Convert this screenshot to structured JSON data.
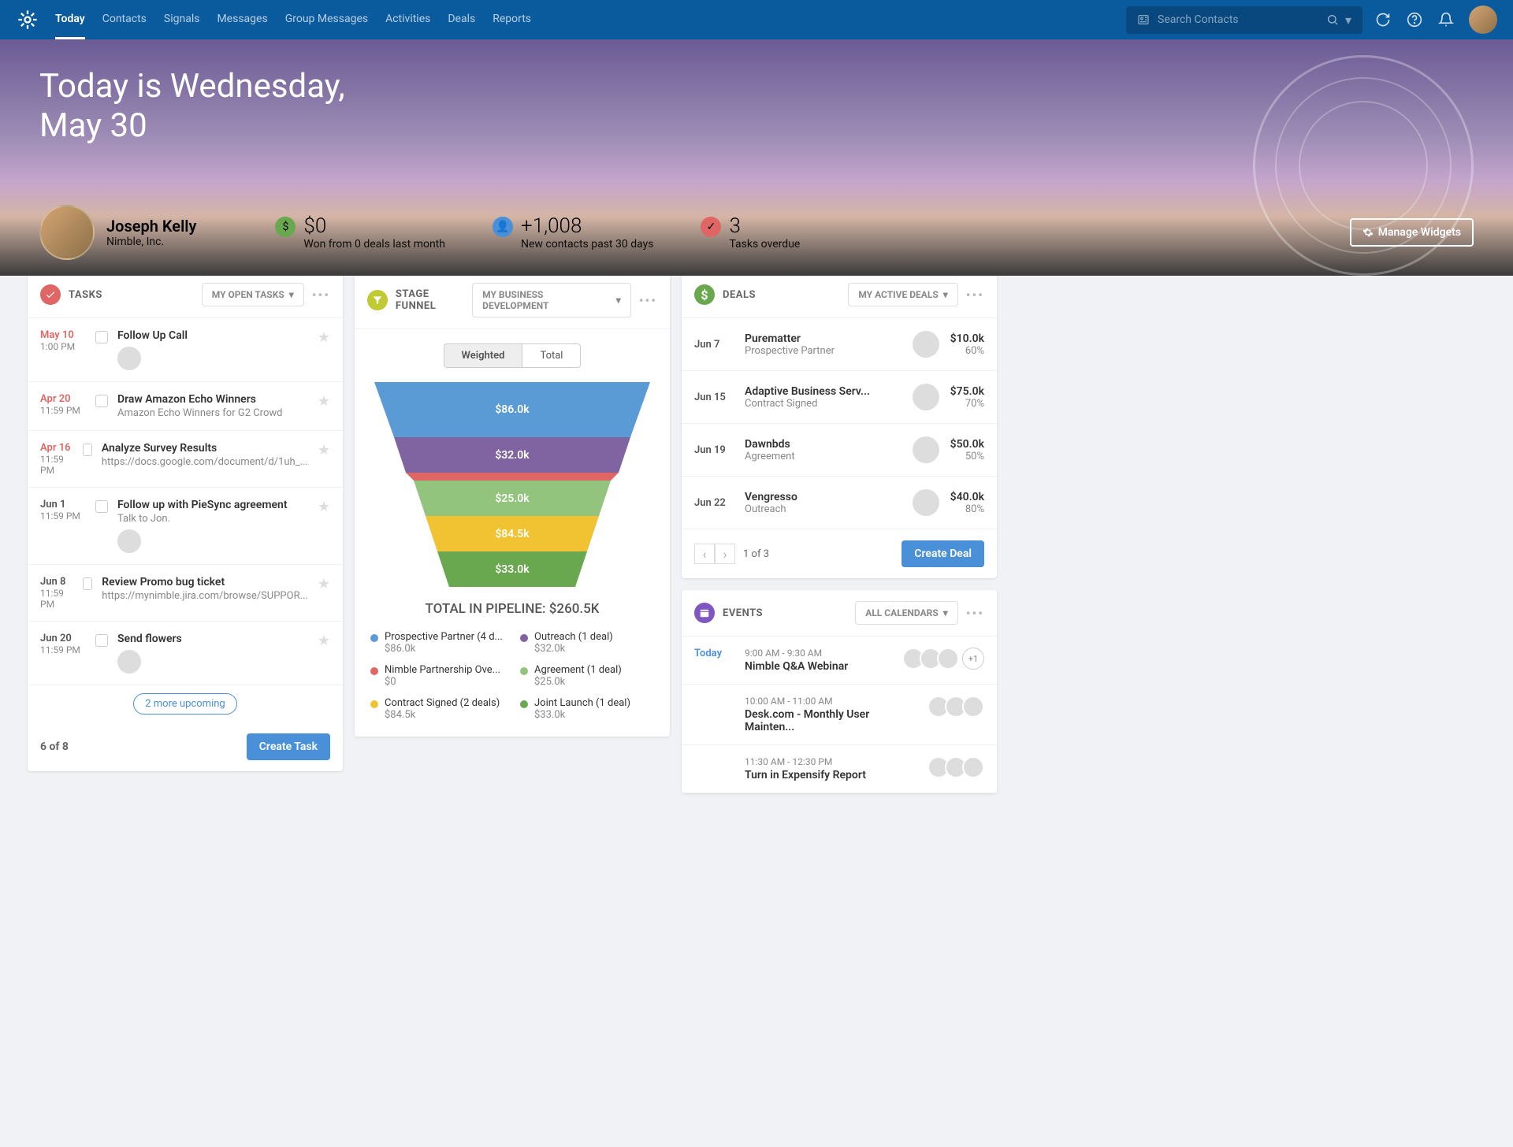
{
  "nav": {
    "items": [
      "Today",
      "Contacts",
      "Signals",
      "Messages",
      "Group Messages",
      "Activities",
      "Deals",
      "Reports"
    ],
    "search_placeholder": "Search Contacts"
  },
  "hero": {
    "title_line1": "Today is Wednesday,",
    "title_line2": "May 30",
    "user_name": "Joseph Kelly",
    "user_company": "Nimble, Inc.",
    "stat1_prefix": "$",
    "stat1_val": "0",
    "stat1_label": "Won from 0 deals last month",
    "stat2_prefix": "+",
    "stat2_val": "1,008",
    "stat2_label": "New contacts past 30 days",
    "stat3_val": "3",
    "stat3_label": "Tasks overdue",
    "manage_btn": "Manage Widgets"
  },
  "tasks": {
    "title": "TASKS",
    "dropdown": "MY OPEN TASKS",
    "items": [
      {
        "date": "May 10",
        "time": "1:00 PM",
        "overdue": true,
        "title": "Follow Up Call",
        "sub": "",
        "avatar": true
      },
      {
        "date": "Apr 20",
        "time": "11:59 PM",
        "overdue": true,
        "title": "Draw Amazon Echo Winners",
        "sub": "Amazon Echo Winners for G2 Crowd"
      },
      {
        "date": "Apr 16",
        "time": "11:59 PM",
        "overdue": true,
        "title": "Analyze Survey Results",
        "sub": "https://docs.google.com/document/d/1uh_..."
      },
      {
        "date": "Jun 1",
        "time": "11:59 PM",
        "overdue": false,
        "title": "Follow up with PieSync agreement",
        "sub": "Talk to Jon.",
        "avatar": true
      },
      {
        "date": "Jun 8",
        "time": "11:59 PM",
        "overdue": false,
        "title": "Review Promo bug ticket",
        "sub": "https://mynimble.jira.com/browse/SUPPOR..."
      },
      {
        "date": "Jun 20",
        "time": "11:59 PM",
        "overdue": false,
        "title": "Send flowers",
        "sub": "",
        "avatar": true
      }
    ],
    "upcoming": "2 more upcoming",
    "count": "6 of 8",
    "create": "Create Task"
  },
  "funnel": {
    "title": "STAGE FUNNEL",
    "dropdown": "MY BUSINESS DEVELOPMENT",
    "toggle": [
      "Weighted",
      "Total"
    ],
    "total_label": "TOTAL IN PIPELINE: $260.5K",
    "legend": [
      {
        "color": "#5b9bd5",
        "label": "Prospective Partner (4 d...",
        "val": "$86.0k"
      },
      {
        "color": "#8064a2",
        "label": "Outreach (1 deal)",
        "val": "$32.0k"
      },
      {
        "color": "#e06666",
        "label": "Nimble Partnership Ove...",
        "val": "$0"
      },
      {
        "color": "#93c47d",
        "label": "Agreement (1 deal)",
        "val": "$25.0k"
      },
      {
        "color": "#f1c232",
        "label": "Contract Signed (2 deals)",
        "val": "$84.5k"
      },
      {
        "color": "#6aa84f",
        "label": "Joint Launch (1 deal)",
        "val": "$33.0k"
      }
    ]
  },
  "chart_data": {
    "type": "funnel",
    "title": "Stage Funnel — Weighted",
    "total": 260.5,
    "unit": "$k",
    "segments": [
      {
        "label": "$86.0k",
        "value": 86.0,
        "color": "#5b9bd5",
        "stage": "Prospective Partner",
        "deals": 4
      },
      {
        "label": "$32.0k",
        "value": 32.0,
        "color": "#8064a2",
        "stage": "Outreach",
        "deals": 1
      },
      {
        "label": "",
        "value": 0,
        "color": "#e06666",
        "stage": "Nimble Partnership Overview",
        "deals": 0
      },
      {
        "label": "$25.0k",
        "value": 25.0,
        "color": "#93c47d",
        "stage": "Agreement",
        "deals": 1
      },
      {
        "label": "$84.5k",
        "value": 84.5,
        "color": "#f1c232",
        "stage": "Contract Signed",
        "deals": 2
      },
      {
        "label": "$33.0k",
        "value": 33.0,
        "color": "#6aa84f",
        "stage": "Joint Launch",
        "deals": 1
      }
    ]
  },
  "deals": {
    "title": "DEALS",
    "dropdown": "MY ACTIVE DEALS",
    "items": [
      {
        "date": "Jun 7",
        "name": "Purematter",
        "stage": "Prospective Partner",
        "val": "$10.0k",
        "pct": "60%"
      },
      {
        "date": "Jun 15",
        "name": "Adaptive Business Serv...",
        "stage": "Contract Signed",
        "val": "$75.0k",
        "pct": "70%"
      },
      {
        "date": "Jun 19",
        "name": "Dawnbds",
        "stage": "Agreement",
        "val": "$50.0k",
        "pct": "50%"
      },
      {
        "date": "Jun 22",
        "name": "Vengresso",
        "stage": "Outreach",
        "val": "$40.0k",
        "pct": "80%"
      }
    ],
    "pager": "1 of 3",
    "create": "Create Deal"
  },
  "events": {
    "title": "EVENTS",
    "dropdown": "ALL CALENDARS",
    "day_label": "Today",
    "items": [
      {
        "time": "9:00 AM - 9:30 AM",
        "name": "Nimble Q&A Webinar",
        "more": "+1"
      },
      {
        "time": "10:00 AM - 11:00 AM",
        "name": "Desk.com - Monthly User Mainten..."
      },
      {
        "time": "11:30 AM - 12:30 PM",
        "name": "Turn in Expensify Report"
      }
    ]
  }
}
